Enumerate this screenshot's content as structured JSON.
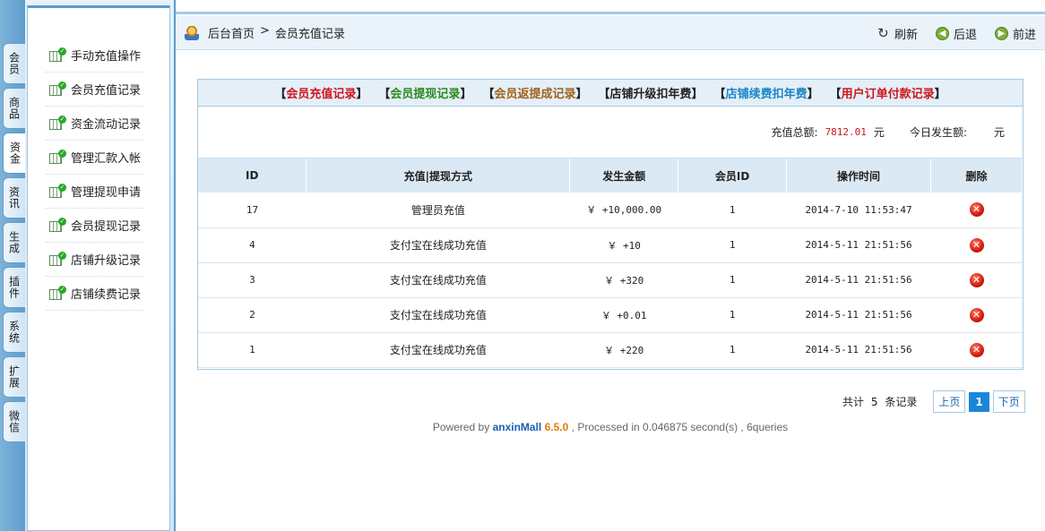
{
  "vtabs": [
    "会员",
    "商品",
    "资金",
    "资讯",
    "生成",
    "插件",
    "系统",
    "扩展",
    "微信"
  ],
  "active_tab": "资金",
  "menu": [
    "手动充值操作",
    "会员充值记录",
    "资金流动记录",
    "管理汇款入帐",
    "管理提现申请",
    "会员提现记录",
    "店铺升级记录",
    "店铺续费记录"
  ],
  "breadcrumb": {
    "home": "后台首页",
    "sep": ">",
    "current": "会员充值记录"
  },
  "nav": {
    "refresh": "刷新",
    "back": "后退",
    "forward": "前进"
  },
  "links": [
    {
      "label": "会员充值记录",
      "color": "#d0141c"
    },
    {
      "label": "会员提现记录",
      "color": "#2a8a1a"
    },
    {
      "label": "会员返提成记录",
      "color": "#a0611a"
    },
    {
      "label": "店铺升级扣年费",
      "color": "#222222"
    },
    {
      "label": "店铺续费扣年费",
      "color": "#1a86c8"
    },
    {
      "label": "用户订单付款记录",
      "color": "#d0141c"
    }
  ],
  "summary": {
    "total_label": "充值总额:",
    "total_value": "7812.01",
    "total_unit": "元",
    "today_label": "今日发生额:",
    "today_value": "",
    "today_unit": "元"
  },
  "table": {
    "headers": [
      "ID",
      "充值|提现方式",
      "发生金额",
      "会员ID",
      "操作时间",
      "删除"
    ],
    "rows": [
      {
        "id": "17",
        "method": "管理员充值",
        "amount": "￥ +10,000.00",
        "member": "1",
        "time": "2014-7-10 11:53:47"
      },
      {
        "id": "4",
        "method": "支付宝在线成功充值",
        "amount": "￥ +10",
        "member": "1",
        "time": "2014-5-11 21:51:56"
      },
      {
        "id": "3",
        "method": "支付宝在线成功充值",
        "amount": "￥ +320",
        "member": "1",
        "time": "2014-5-11 21:51:56"
      },
      {
        "id": "2",
        "method": "支付宝在线成功充值",
        "amount": "￥ +0.01",
        "member": "1",
        "time": "2014-5-11 21:51:56"
      },
      {
        "id": "1",
        "method": "支付宝在线成功充值",
        "amount": "￥ +220",
        "member": "1",
        "time": "2014-5-11 21:51:56"
      }
    ]
  },
  "pager": {
    "count_prefix": "共计",
    "count": "5",
    "count_suffix": "条记录",
    "prev": "上页",
    "current": "1",
    "next": "下页"
  },
  "footer": {
    "prefix": "Powered by",
    "brand": "anxinMall",
    "version": "6.5.0",
    "suffix": ", Processed in 0.046875 second(s) , 6queries"
  }
}
